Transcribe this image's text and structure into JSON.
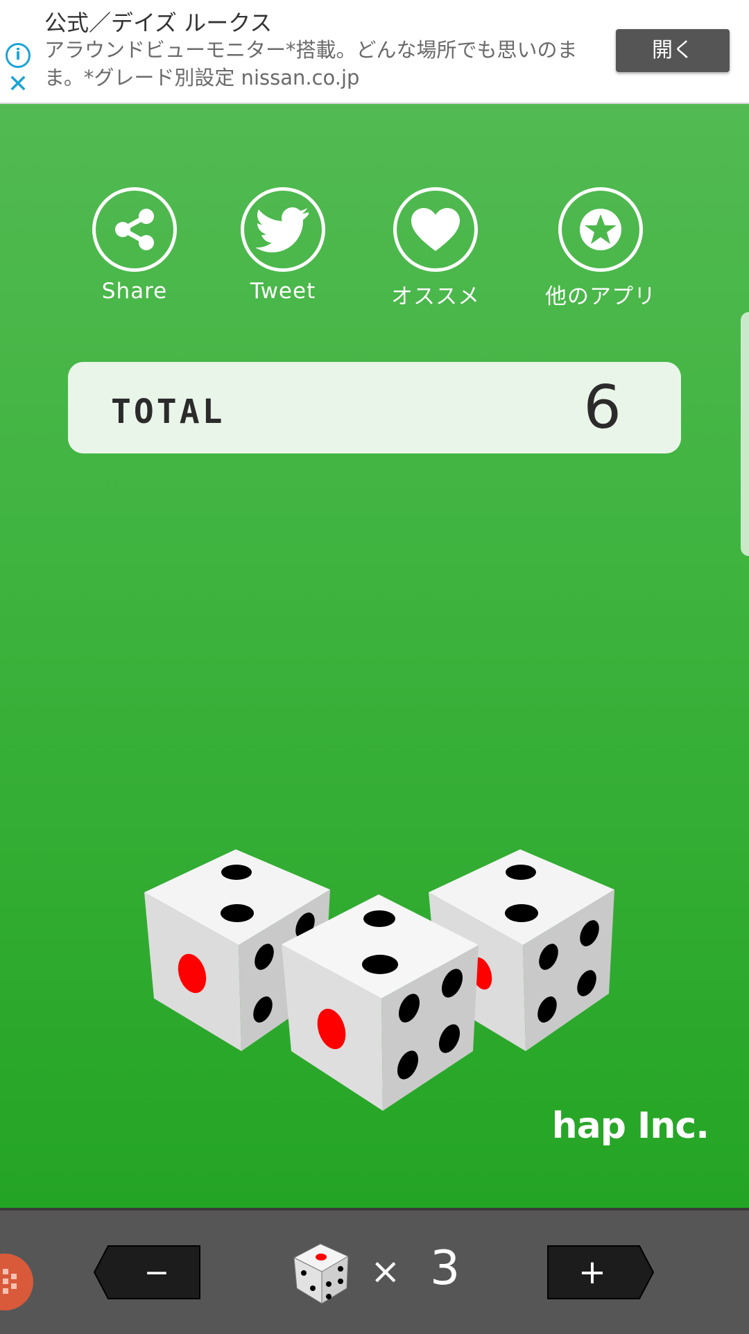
{
  "ad": {
    "title": "公式／デイズ ルークス",
    "text": "アラウンドビューモニター*搭載。どんな場所でも思いのまま。*グレード別設定 nissan.co.jp",
    "open_button": "開く",
    "info_icon": "info-icon",
    "close_icon": "close-icon"
  },
  "social": {
    "share": "Share",
    "tweet": "Tweet",
    "recommend": "オススメ",
    "other_apps": "他のアプリ"
  },
  "total": {
    "label": "TOTAL",
    "value": "6"
  },
  "brand": "hap Inc.",
  "controls": {
    "minus": "−",
    "plus": "+",
    "times": "×",
    "dice_count": "3"
  },
  "colors": {
    "game_bg_top": "#52ba52",
    "game_bg_bottom": "#24a424",
    "bottom_bar": "#565656",
    "pip_red": "#ff0000",
    "ad_accent": "#1aa3d8"
  }
}
